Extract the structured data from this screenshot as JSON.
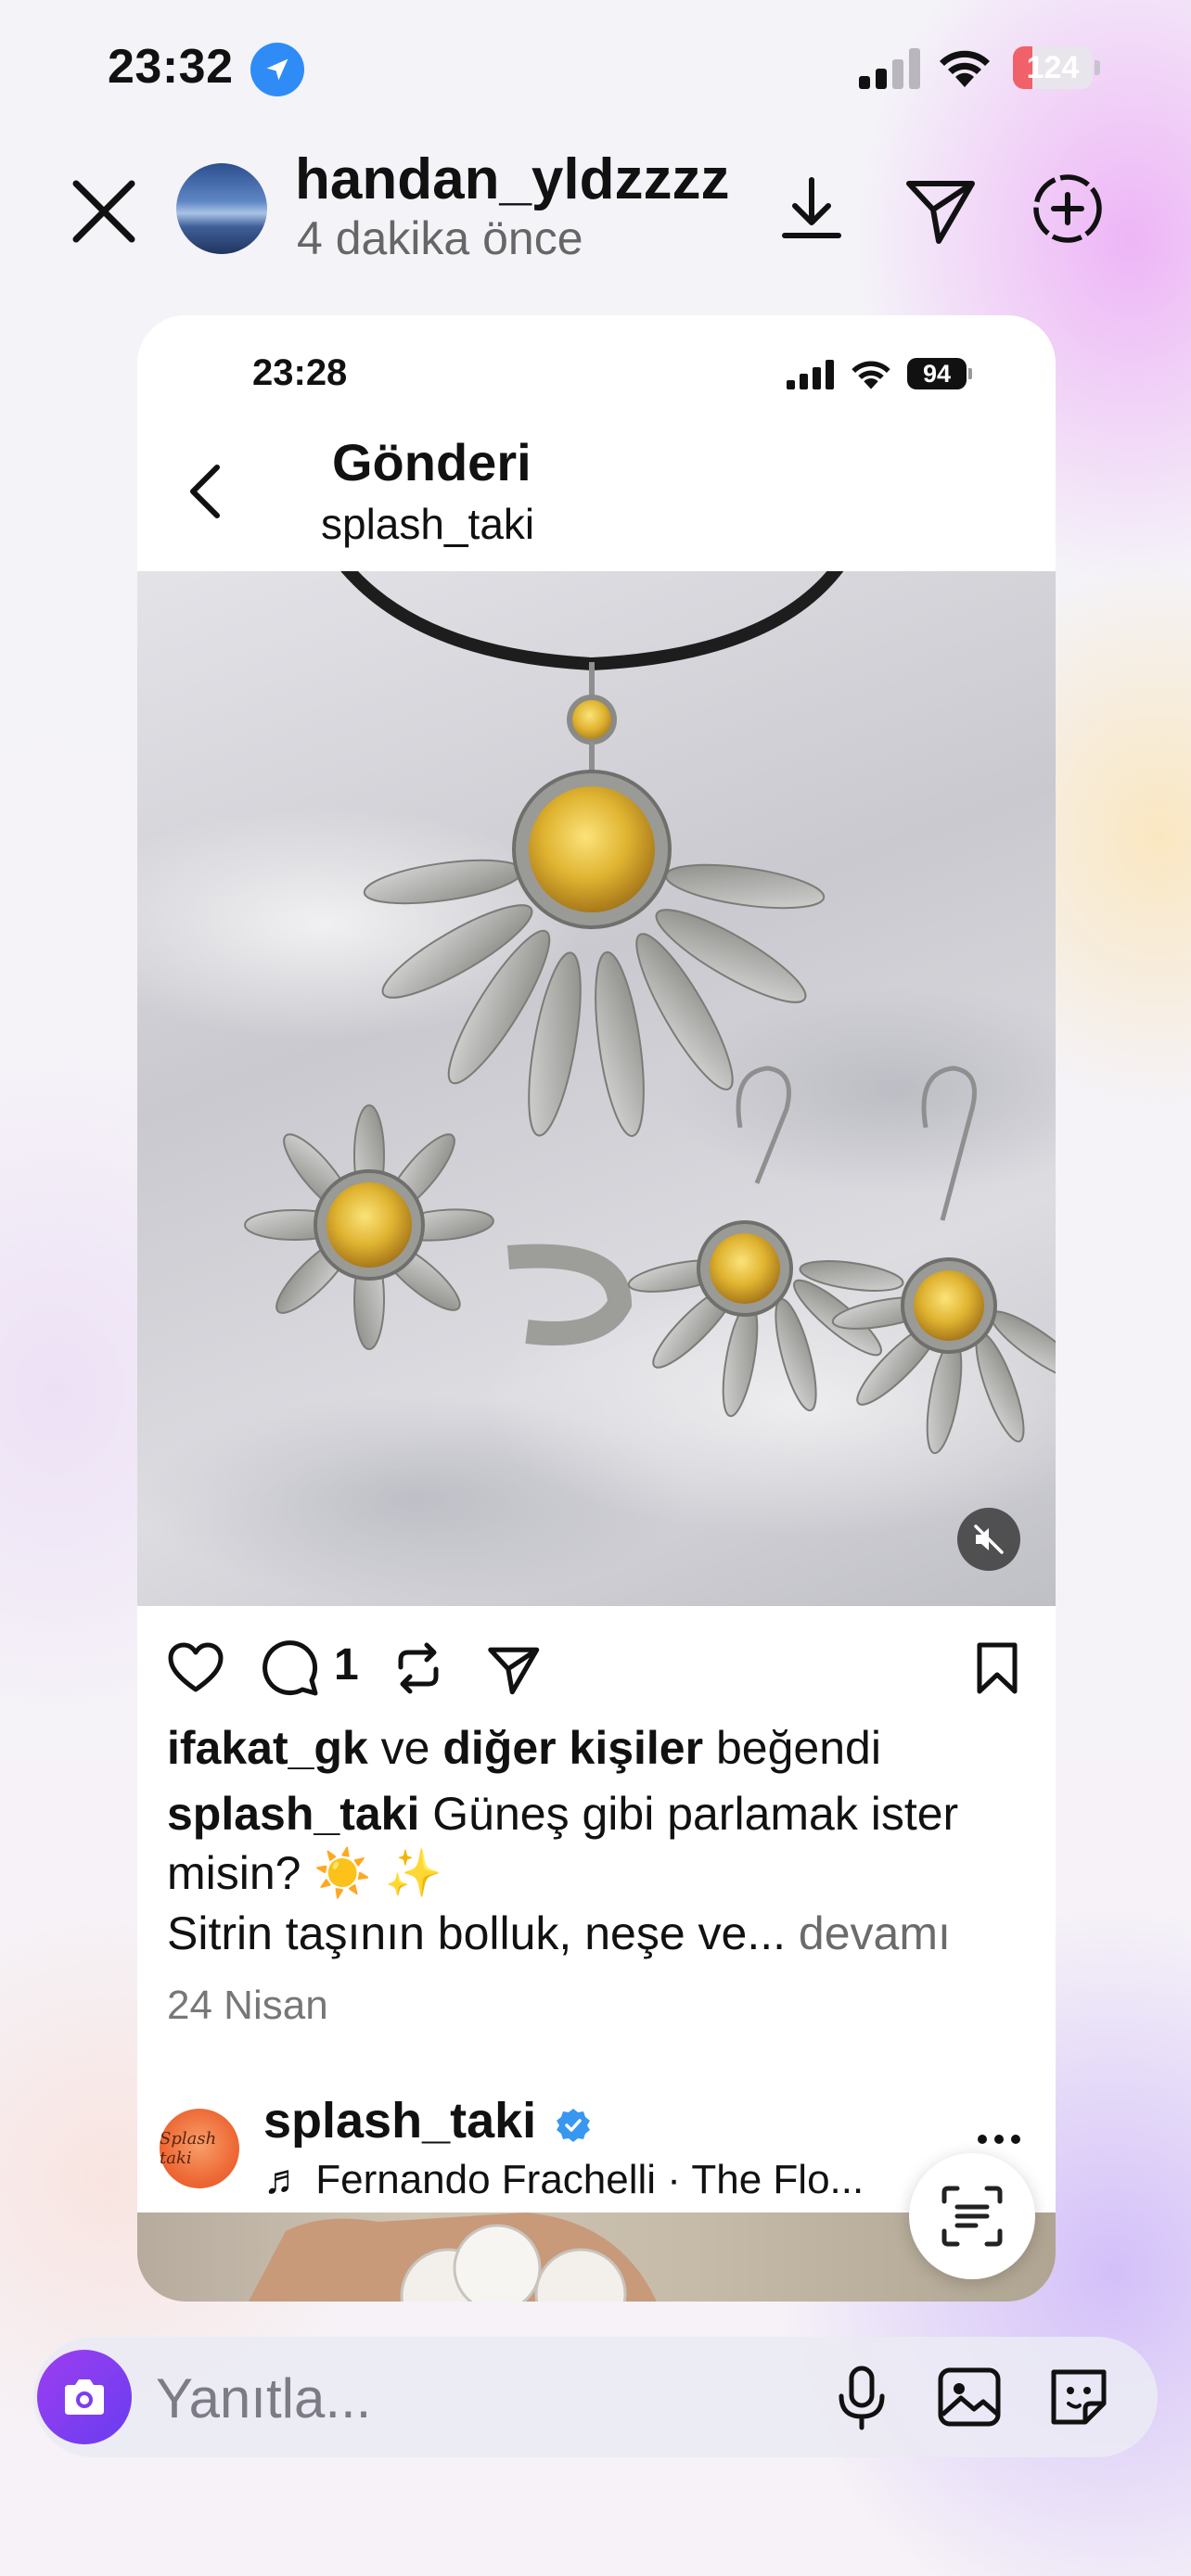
{
  "status_bar": {
    "time": "23:32",
    "battery": "124",
    "battery_level": 0.24
  },
  "story": {
    "username": "handan_yldzzzz",
    "time_ago": "4 dakika önce"
  },
  "shared_post": {
    "status_time": "23:28",
    "status_battery": "94",
    "header_title": "Gönderi",
    "header_subtitle": "splash_taki",
    "comment_count": "1",
    "likes_user": "ifakat_gk",
    "likes_and": " ve ",
    "likes_others": "diğer kişiler",
    "likes_suffix": " beğendi",
    "caption_user": "splash_taki",
    "caption_text": " Güneş gibi parlamak ister misin? ☀️ ✨",
    "caption_line2": "Sitrin taşının bolluk, neşe ve...",
    "caption_more": " devamı",
    "date": "24 Nisan",
    "next_post": {
      "username": "splash_taki",
      "avatar_text": "Splash taki",
      "music": "♬ Fernando Frachelli · The Flo..."
    }
  },
  "reply": {
    "placeholder": "Yanıtla..."
  },
  "colors": {
    "accent_blue": "#2f8cf6",
    "battery_red": "#f0616a",
    "camera_purple": "#7b3ef0",
    "verified_blue": "#3897f0"
  }
}
